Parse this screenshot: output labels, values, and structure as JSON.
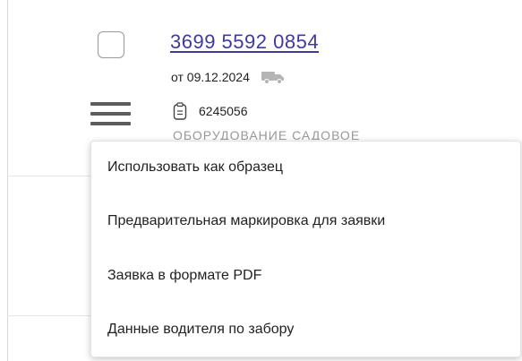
{
  "order": {
    "number": "3699 5592 0854",
    "date": "от 09.12.2024",
    "doc_number": "6245056",
    "category": "ОБОРУДОВАНИЕ САДОВОЕ"
  },
  "icons": {
    "truck": "truck-icon",
    "document": "clipboard-icon",
    "menu": "hamburger-menu-icon"
  },
  "context_menu": {
    "items": [
      {
        "label": "Использовать как образец"
      },
      {
        "label": "Предварительная маркировка для заявки"
      },
      {
        "label": "Заявка в формате PDF"
      },
      {
        "label": "Данные водителя по забору"
      }
    ]
  },
  "colors": {
    "link": "#3f3aa0",
    "muted_text": "#9a9a9a",
    "icon_gray": "#5c5c5c"
  }
}
